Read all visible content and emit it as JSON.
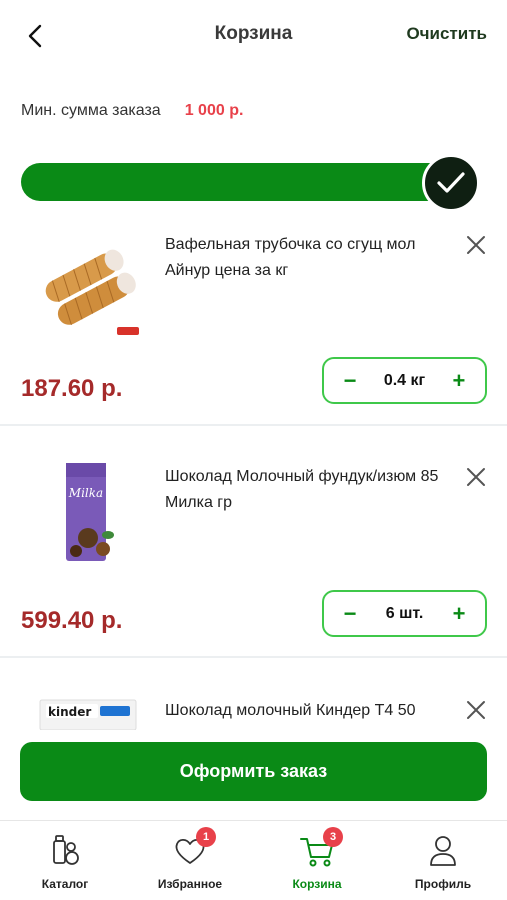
{
  "header": {
    "title": "Корзина",
    "clear_label": "Очистить"
  },
  "min_sum": {
    "label": "Мин. сумма заказа",
    "value": "1 000 р."
  },
  "progress": {
    "fraction": 1.0,
    "complete": true,
    "color": "#0a8a16"
  },
  "items": [
    {
      "name": "Вафельная трубочка со сгущ мол Айнур цена за кг",
      "price": "187.60 р.",
      "quantity": "0.4 кг",
      "image_icon": "wafer-rolls-image"
    },
    {
      "name": "Шоколад Молочный фундук/изюм 85 Милка гр",
      "price": "599.40 р.",
      "quantity": "6 шт.",
      "image_icon": "milka-chocolate-image",
      "image_brand": "Milka"
    },
    {
      "name": "Шоколад молочный Киндер Т4 50",
      "image_icon": "kinder-chocolate-image",
      "image_brand": "kinder"
    }
  ],
  "order_button": {
    "label": "Оформить заказ"
  },
  "tabbar": {
    "tabs": [
      {
        "label": "Каталог",
        "icon": "catalog-icon"
      },
      {
        "label": "Избранное",
        "icon": "heart-icon",
        "badge": "1"
      },
      {
        "label": "Корзина",
        "icon": "cart-icon",
        "badge": "3",
        "active": true
      },
      {
        "label": "Профиль",
        "icon": "profile-icon"
      }
    ]
  },
  "colors": {
    "accent_green": "#0a8a16",
    "price_red": "#a52a2a",
    "badge_red": "#e8414a"
  }
}
